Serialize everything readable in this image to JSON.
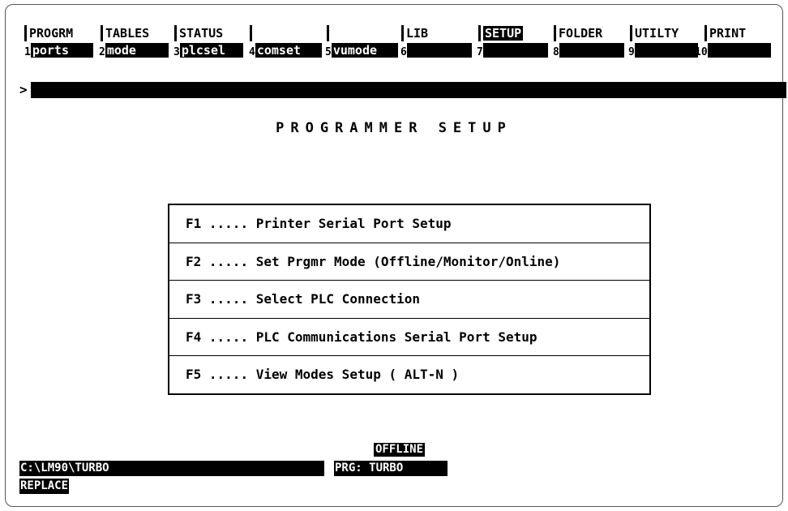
{
  "menu": {
    "top": [
      {
        "label": "PROGRM",
        "active": false
      },
      {
        "label": "TABLES",
        "active": false
      },
      {
        "label": "STATUS",
        "active": false
      },
      {
        "label": "",
        "active": false
      },
      {
        "label": "",
        "active": false
      },
      {
        "label": "LIB",
        "active": false
      },
      {
        "label": "SETUP",
        "active": true
      },
      {
        "label": "FOLDER",
        "active": false
      },
      {
        "label": "UTILTY",
        "active": false
      },
      {
        "label": "PRINT",
        "active": false
      }
    ],
    "keys": [
      {
        "num": "1",
        "label": "ports"
      },
      {
        "num": "2",
        "label": "mode"
      },
      {
        "num": "3",
        "label": "plcsel"
      },
      {
        "num": "4",
        "label": "comset"
      },
      {
        "num": "5",
        "label": "vumode"
      },
      {
        "num": "6",
        "label": ""
      },
      {
        "num": "7",
        "label": ""
      },
      {
        "num": "8",
        "label": ""
      },
      {
        "num": "9",
        "label": ""
      },
      {
        "num": "10",
        "label": ""
      }
    ]
  },
  "command": {
    "prompt": ">",
    "value": ""
  },
  "title": "PROGRAMMER SETUP",
  "options": [
    {
      "key": "F1",
      "dots": ".....",
      "text": "Printer Serial Port Setup"
    },
    {
      "key": "F2",
      "dots": ".....",
      "text": "Set Prgmr Mode (Offline/Monitor/Online)"
    },
    {
      "key": "F3",
      "dots": ".....",
      "text": "Select PLC Connection"
    },
    {
      "key": "F4",
      "dots": ".....",
      "text": "PLC Communications Serial Port Setup"
    },
    {
      "key": "F5",
      "dots": ".....",
      "text": "View Modes Setup ( ALT-N )"
    }
  ],
  "status": {
    "mode": "OFFLINE",
    "path": "C:\\LM90\\TURBO",
    "program": "PRG: TURBO",
    "edit_mode": "REPLACE"
  },
  "colors": {
    "background": "#ffffff",
    "foreground": "#000000"
  }
}
